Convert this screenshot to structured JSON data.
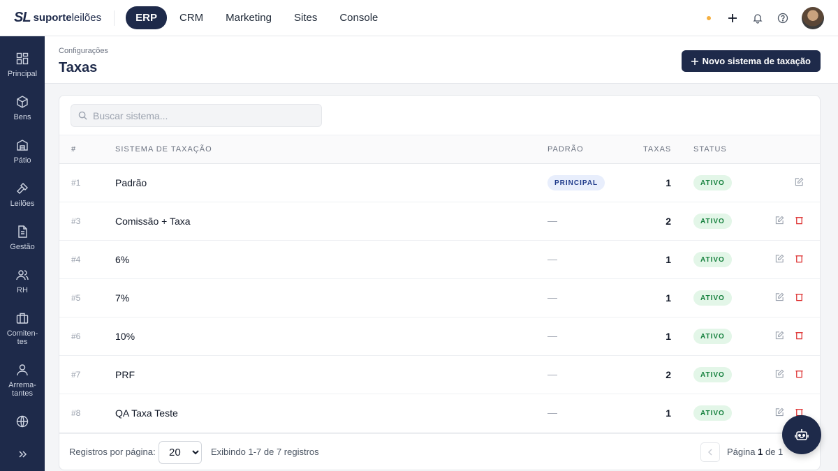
{
  "app": {
    "logo_mark": "SL",
    "logo_word1": "suporte",
    "logo_word2": "leilões"
  },
  "topnav": [
    {
      "label": "ERP",
      "active": true
    },
    {
      "label": "CRM"
    },
    {
      "label": "Marketing"
    },
    {
      "label": "Sites"
    },
    {
      "label": "Console"
    }
  ],
  "sidebar": {
    "items": [
      {
        "label": "Principal",
        "icon": "grid-icon"
      },
      {
        "label": "Bens",
        "icon": "box-icon"
      },
      {
        "label": "Pátio",
        "icon": "warehouse-icon"
      },
      {
        "label": "Leilões",
        "icon": "gavel-icon"
      },
      {
        "label": "Gestão",
        "icon": "document-icon"
      },
      {
        "label": "RH",
        "icon": "users-icon"
      },
      {
        "label": "Comiten-",
        "label2": "tes",
        "icon": "briefcase-icon"
      },
      {
        "label": "Arrema-",
        "label2": "tantes",
        "icon": "user-icon"
      },
      {
        "label": "",
        "icon": "globe-icon"
      }
    ]
  },
  "page": {
    "breadcrumb": "Configurações",
    "title": "Taxas",
    "new_button": "Novo sistema de taxação"
  },
  "search": {
    "placeholder": "Buscar sistema..."
  },
  "table": {
    "headers": {
      "id": "#",
      "name": "SISTEMA DE TAXAÇÃO",
      "default": "PADRÃO",
      "count": "TAXAS",
      "status": "STATUS"
    },
    "rows": [
      {
        "id": "#1",
        "name": "Padrão",
        "default": "PRINCIPAL",
        "count": "1",
        "status": "ATIVO",
        "deletable": false
      },
      {
        "id": "#3",
        "name": "Comissão + Taxa",
        "default": "—",
        "count": "2",
        "status": "ATIVO",
        "deletable": true
      },
      {
        "id": "#4",
        "name": "6%",
        "default": "—",
        "count": "1",
        "status": "ATIVO",
        "deletable": true
      },
      {
        "id": "#5",
        "name": "7%",
        "default": "—",
        "count": "1",
        "status": "ATIVO",
        "deletable": true
      },
      {
        "id": "#6",
        "name": "10%",
        "default": "—",
        "count": "1",
        "status": "ATIVO",
        "deletable": true
      },
      {
        "id": "#7",
        "name": "PRF",
        "default": "—",
        "count": "2",
        "status": "ATIVO",
        "deletable": true
      },
      {
        "id": "#8",
        "name": "QA Taxa Teste",
        "default": "—",
        "count": "1",
        "status": "ATIVO",
        "deletable": true
      }
    ]
  },
  "footer": {
    "per_page_label": "Registros por página:",
    "per_page_value": "20",
    "info": "Exibindo 1-7 de 7 registros",
    "page_prefix": "Página",
    "page_current": "1",
    "page_of": "de 1"
  },
  "colors": {
    "brand": "#1e2a4a",
    "active_badge": "#15803d",
    "delete": "#dc2626",
    "status_dot": "#f5b041"
  }
}
